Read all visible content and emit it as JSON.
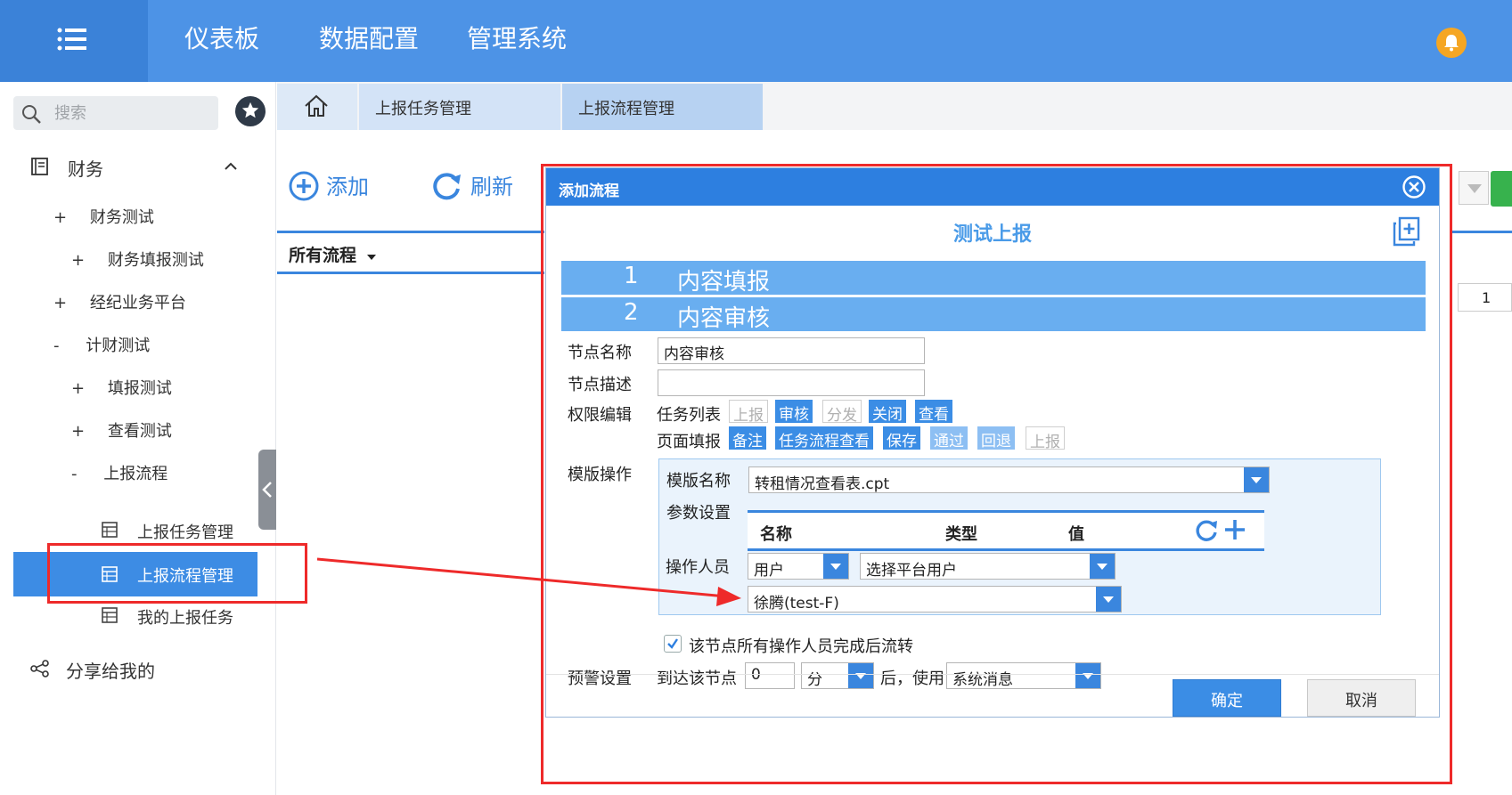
{
  "topbar": {
    "nav": [
      "仪表板",
      "数据配置",
      "管理系统"
    ]
  },
  "sidebar": {
    "search_placeholder": "搜索",
    "section_finance": "财务",
    "items": [
      {
        "prefix": "+",
        "label": "财务测试"
      },
      {
        "prefix": "+",
        "label": "财务填报测试"
      },
      {
        "prefix": "+",
        "label": "经纪业务平台"
      },
      {
        "prefix": "-",
        "label": "计财测试"
      },
      {
        "prefix": "+",
        "label": "填报测试"
      },
      {
        "prefix": "+",
        "label": "查看测试"
      },
      {
        "prefix": "-",
        "label": "上报流程"
      }
    ],
    "leaf_items": [
      "上报任务管理",
      "上报流程管理",
      "我的上报任务"
    ],
    "share": "分享给我的"
  },
  "tabs": [
    "上报任务管理",
    "上报流程管理"
  ],
  "toolbar": {
    "add": "添加",
    "refresh": "刷新",
    "all_flows": "所有流程",
    "page_number": "1"
  },
  "dialog": {
    "title": "添加流程",
    "subtitle": "测试上报",
    "steps": [
      {
        "num": "1",
        "label": "内容填报"
      },
      {
        "num": "2",
        "label": "内容审核"
      }
    ],
    "node_name_label": "节点名称",
    "node_name_value": "内容审核",
    "node_desc_label": "节点描述",
    "node_desc_value": "",
    "perm_label": "权限编辑",
    "task_list_label": "任务列表",
    "task_list_buttons": [
      {
        "label": "上报",
        "state": "off"
      },
      {
        "label": "审核",
        "state": "on"
      },
      {
        "label": "分发",
        "state": "off"
      },
      {
        "label": "关闭",
        "state": "on"
      },
      {
        "label": "查看",
        "state": "on"
      }
    ],
    "page_fill_label": "页面填报",
    "page_fill_buttons": [
      {
        "label": "备注",
        "state": "on"
      },
      {
        "label": "任务流程查看",
        "state": "on"
      },
      {
        "label": "保存",
        "state": "on"
      },
      {
        "label": "通过",
        "state": "mid"
      },
      {
        "label": "回退",
        "state": "mid"
      },
      {
        "label": "上报",
        "state": "off"
      }
    ],
    "template_op_label": "模版操作",
    "template_name_label": "模版名称",
    "template_name_value": "转租情况查看表.cpt",
    "param_label": "参数设置",
    "param_columns": [
      "名称",
      "类型",
      "值"
    ],
    "operator_label": "操作人员",
    "operator_type": "用户",
    "operator_select": "选择平台用户",
    "operator_user": "徐腾(test-F)",
    "checkbox_label": "该节点所有操作人员完成后流转",
    "warning_label": "预警设置",
    "warning_prefix": "到达该节点",
    "warning_value": "0",
    "warning_unit": "分",
    "warning_after": "后，使用",
    "warning_method": "系统消息",
    "ok": "确定",
    "cancel": "取消"
  },
  "colors": {
    "topbar": "#4d93e6",
    "accent": "#3a86de",
    "annotation": "#ee2a2a"
  }
}
